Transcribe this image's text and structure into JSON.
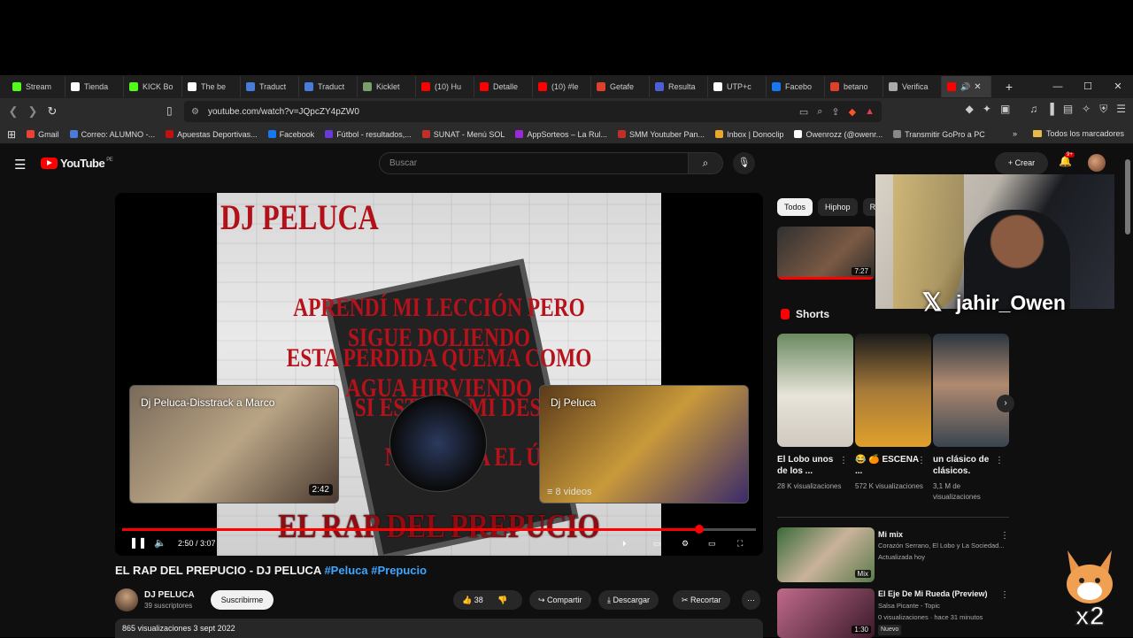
{
  "browser": {
    "tabs": [
      {
        "label": "Stream",
        "color": "#53fc18"
      },
      {
        "label": "Tienda",
        "color": "#ffffff"
      },
      {
        "label": "KICK Bo",
        "color": "#53fc18"
      },
      {
        "label": "The be",
        "color": "#ffffff"
      },
      {
        "label": "Traduct",
        "color": "#4a7bd8"
      },
      {
        "label": "Traduct",
        "color": "#4a7bd8"
      },
      {
        "label": "Kicklet",
        "color": "#7aa06a"
      },
      {
        "label": "(10) Hu",
        "color": "#ff0000"
      },
      {
        "label": "Detalle",
        "color": "#ff0000"
      },
      {
        "label": "(10) #le",
        "color": "#ff0000"
      },
      {
        "label": "Getafe",
        "color": "#e0402a"
      },
      {
        "label": "Resulta",
        "color": "#4a5fd8"
      },
      {
        "label": "UTP+c",
        "color": "#ffffff"
      },
      {
        "label": "Facebo",
        "color": "#1877f2"
      },
      {
        "label": "betano",
        "color": "#e0402a"
      },
      {
        "label": "Verifica",
        "color": "#aaaaaa"
      }
    ],
    "active_tab_label": "",
    "url": "youtube.com/watch?v=JQpcZY4pZW0",
    "bookmarks": [
      "Gmail",
      "Correo: ALUMNO -...",
      "Apuestas Deportivas...",
      "Facebook",
      "Fútbol - resultados,...",
      "SUNAT - Menú SOL",
      "AppSorteos – La Rul...",
      "SMM Youtuber Pan...",
      "Inbox | Donoclip",
      "Owenrozz (@owenr...",
      "Transmitir GoPro a PC"
    ],
    "bookmarks_all": "Todos los marcadores"
  },
  "yt": {
    "logo": "YouTube",
    "country": "PE",
    "search_placeholder": "Buscar",
    "create": "Crear",
    "notif": "9+"
  },
  "video": {
    "overlay_title": "DJ PELUCA",
    "lyrics": [
      "APRENDÍ MI LECCIÓN PERO SIGUE DOLIENDO",
      "ESTA PERDIDA QUEMA COMO AGUA HIRVIENDO",
      "SI ESTE ES MI DESTINO",
      "N MI VIDA EL ÚNI"
    ],
    "big_title": "EL RAP DEL PREPUCIO",
    "endcard1_title": "Dj Peluca-Disstrack a Marco",
    "endcard1_duration": "2:42",
    "endcard2_title": "Dj Peluca",
    "endcard2_count": "8 videos",
    "time": "2:50 / 3:07",
    "progress": 0.91,
    "title_main": "EL RAP DEL PREPUCIO - DJ PELUCA ",
    "tag1": "#Peluca",
    "tag2": "#Prepucio",
    "channel": "DJ PELUCA",
    "subs": "39 suscriptores",
    "subscribe": "Suscribirme",
    "likes": "38",
    "share": "Compartir",
    "download": "Descargar",
    "clip": "Recortar",
    "desc": "865 visualizaciones  3 sept 2022"
  },
  "sidebar": {
    "chips": [
      "Todos",
      "Hiphop",
      "R"
    ],
    "first_dur": "7:27",
    "shorts_label": "Shorts",
    "shorts": [
      {
        "title": "El Lobo unos de los ...",
        "views": "28 K visualizaciones"
      },
      {
        "title": "😂 🍊 ESCENA ...",
        "views": "572 K visualizaciones"
      },
      {
        "title": "un clásico de clásicos.",
        "views": "3,1 M de visualizaciones"
      }
    ],
    "rows": [
      {
        "title": "Mi mix",
        "sub1": "Corazón Serrano, El Lobo y La Sociedad...",
        "sub2": "Actualizada hoy",
        "badge": "Mix"
      },
      {
        "title": "El Eje De Mi Rueda (Preview)",
        "sub1": "Salsa Picante - Topic",
        "sub2": "0 visualizaciones · hace 31 minutos",
        "new": "Nuevo",
        "dur": "1:30"
      }
    ]
  },
  "overlay": {
    "handle": "jahir_Owen",
    "multiplier": "x2"
  }
}
